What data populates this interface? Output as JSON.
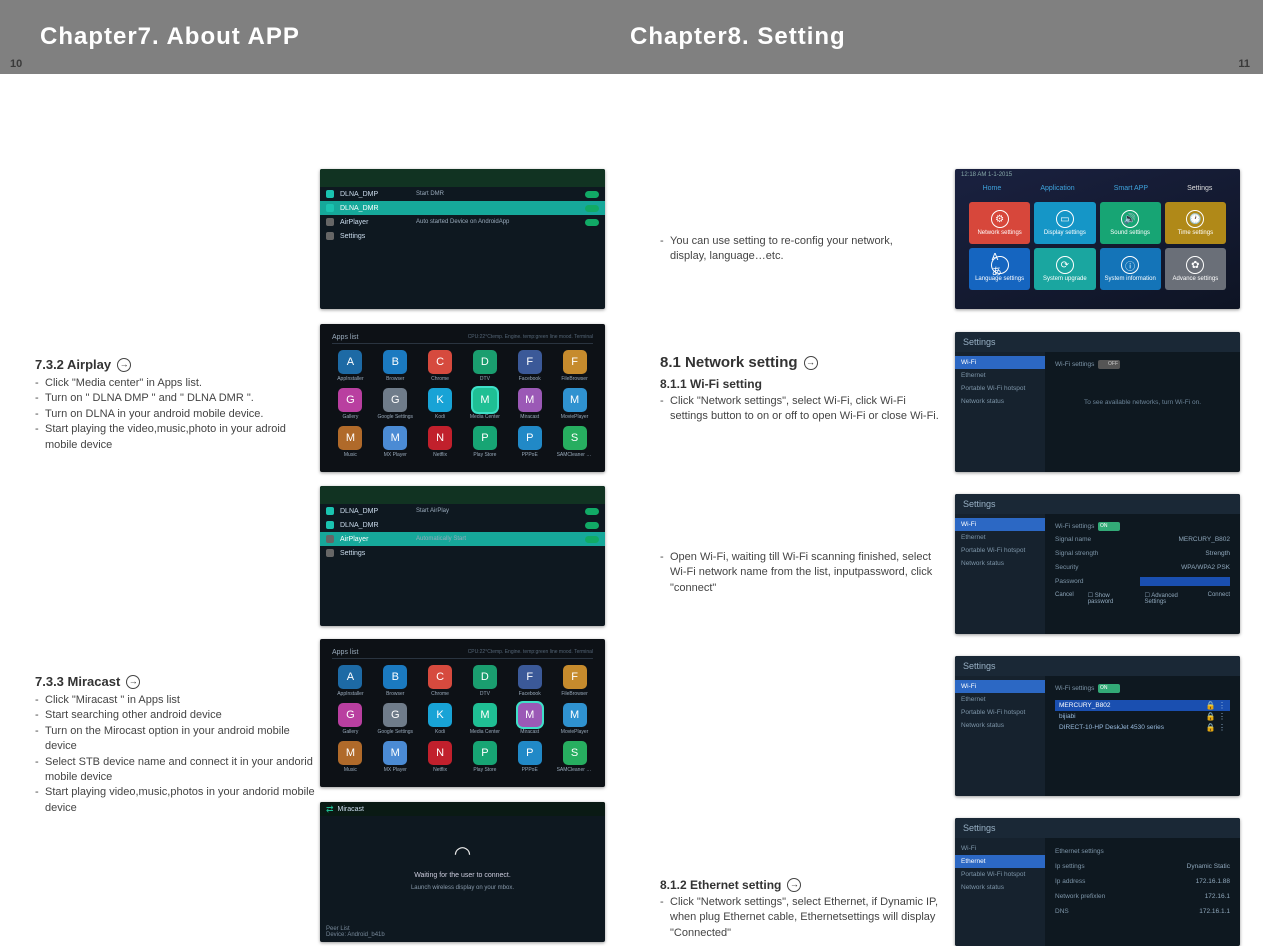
{
  "header": {
    "left": "Chapter7.  About APP",
    "right": "Chapter8.  Setting"
  },
  "page_left_num": "10",
  "page_right_num": "11",
  "left": {
    "airplay": {
      "title": "7.3.2 Airplay",
      "items": [
        "Click \"Media center\" in Apps list.",
        "Turn on \" DLNA DMP \" and \" DLNA DMR \".",
        "Turn on DLNA in your android mobile device.",
        "Start playing the video,music,photo in your adroid mobile device"
      ]
    },
    "miracast": {
      "title": "7.3.3 Miracast",
      "items": [
        "Click \"Miracast \" in Apps list",
        "Start searching other android device",
        "Turn on the Mirocast option in your android mobile device",
        "Select STB device name and connect it in your andorid mobile device",
        "Start playing video,music,photos in your andorid mobile device"
      ]
    },
    "shot1": {
      "rows": [
        "DLNA_DMP",
        "DLNA_DMR",
        "AirPlayer",
        "Settings"
      ],
      "right": [
        "Start DMR",
        "",
        "Auto started Device on AndroidApp",
        ""
      ]
    },
    "shot3": {
      "rows": [
        "DLNA_DMP",
        "DLNA_DMR",
        "AirPlayer",
        "Settings"
      ],
      "right": [
        "Start AirPlay",
        "",
        "Automatically Start",
        ""
      ]
    },
    "apps": {
      "header": "Apps list",
      "items": [
        "AppInstaller",
        "Browser",
        "Chrome",
        "DTV",
        "Facebook",
        "FileBrowser",
        "Gallery",
        "Google Settings",
        "Kodi",
        "Media Center",
        "Miracast",
        "MoviePlayer",
        "Music",
        "MX Player",
        "Netflix",
        "Play Store",
        "PPPoE",
        "SAMCleaner Pro"
      ]
    },
    "miracast_shot": {
      "title": "Miracast",
      "wait": "Waiting for the user to connect.",
      "sub": "Launch wireless display on your mbox.",
      "peer": "Peer List",
      "device": "Device:   Android_b41b"
    }
  },
  "right": {
    "intro": "You can use setting to re-config your network, display, language…etc.",
    "tiles": {
      "time": "12:18 AM  1-1-2015",
      "tabs": [
        "Home",
        "Application",
        "Smart APP",
        "Settings"
      ],
      "items": [
        "Network settings",
        "Display settings",
        "Sound settings",
        "Time settings",
        "Language settings",
        "System upgrade",
        "System information",
        "Advance settings"
      ]
    },
    "s81": {
      "title": "8.1 Network setting",
      "sub": "8.1.1 Wi-Fi setting",
      "text": "Click \"Network settings\", select Wi-Fi, click Wi-Fi settings button to on or off to open Wi-Fi or close Wi-Fi."
    },
    "s_wifi_off": {
      "head": "Settings",
      "menu": [
        "Wi-Fi",
        "Ethernet",
        "Portable Wi-Fi hotspot",
        "Network status"
      ],
      "line": "Wi-Fi settings",
      "hint": "To see available networks, turn Wi-Fi on."
    },
    "s_wifi_connect": {
      "text": "Open Wi-Fi, waiting till Wi-Fi scanning finished, select Wi-Fi network name from the list, inputpassword, click \"connect\"",
      "fields": {
        "signal": "Signal name",
        "signalv": "MERCURY_B802",
        "strength": "Signal strength",
        "strengthv": "Strength",
        "security": "Security",
        "securityv": "WPA/WPA2 PSK",
        "password": "Password"
      },
      "buttons": [
        "Cancel",
        "Show password",
        "Advanced Settings",
        "Connect"
      ]
    },
    "s_wifi_list": {
      "items": [
        "MERCURY_B802",
        "bijiabi",
        "DIRECT-10-HP DeskJet 4530 series"
      ]
    },
    "s812": {
      "title": "8.1.2 Ethernet  setting",
      "text": "Click \"Network settings\", select Ethernet, if Dynamic IP, when plug Ethernet cable, Ethernetsettings will display \"Connected\""
    },
    "s_eth": {
      "head": "Settings",
      "fields": [
        "Ethernet settings",
        "Ip settings",
        "Ip address",
        "Network prefixlen",
        "DNS"
      ],
      "vals": [
        "",
        "Dynamic   Static",
        "172.16.1.88",
        "172.16.1",
        "172.16.1.1"
      ]
    }
  },
  "icon_colors": {
    "apps": [
      "#1d6aa5",
      "#1b7ac0",
      "#d64a3e",
      "#1a9e6f",
      "#3b5998",
      "#c68b2d",
      "#b93fa0",
      "#6f7c8a",
      "#18a3d6",
      "#1fbf94",
      "#9b59b6",
      "#2f92d0",
      "#b06a2a",
      "#4b8bd4",
      "#c1202c",
      "#17a574",
      "#2189c7",
      "#27ae60"
    ],
    "tiles": [
      "#d7473b",
      "#1596c7",
      "#17a574",
      "#b08918",
      "#1565c0",
      "#1aa6a0",
      "#1474b8",
      "#6a6f78"
    ]
  }
}
